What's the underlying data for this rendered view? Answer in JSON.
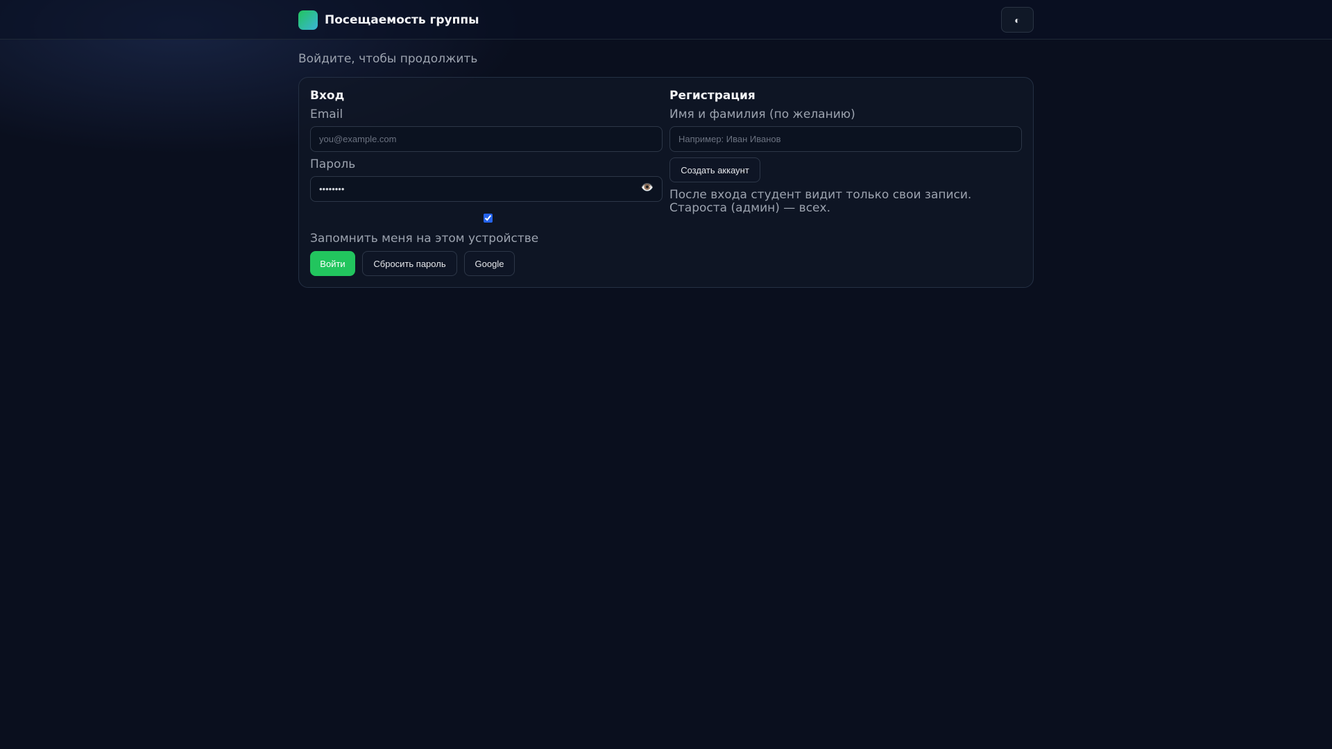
{
  "header": {
    "app_title": "Посещаемость группы",
    "theme_toggle_icon": "◐"
  },
  "subtitle": "Войдите, чтобы продолжить",
  "login": {
    "title": "Вход",
    "email_label": "Email",
    "email_placeholder": "you@example.com",
    "password_label": "Пароль",
    "password_value": "••••••••",
    "show_password_icon": "👁️",
    "remember_checked": true,
    "remember_label": "Запомнить меня на этом устройстве",
    "submit_label": "Войти",
    "reset_label": "Сбросить пароль",
    "google_label": "Google"
  },
  "register": {
    "title": "Регистрация",
    "name_label": "Имя и фамилия (по желанию)",
    "name_placeholder": "Например: Иван Иванов",
    "create_label": "Создать аккаунт",
    "note": "После входа студент видит только свои записи. Староста (админ) — всех."
  },
  "colors": {
    "accent": "#22c55e",
    "background": "#0a0f1e"
  }
}
